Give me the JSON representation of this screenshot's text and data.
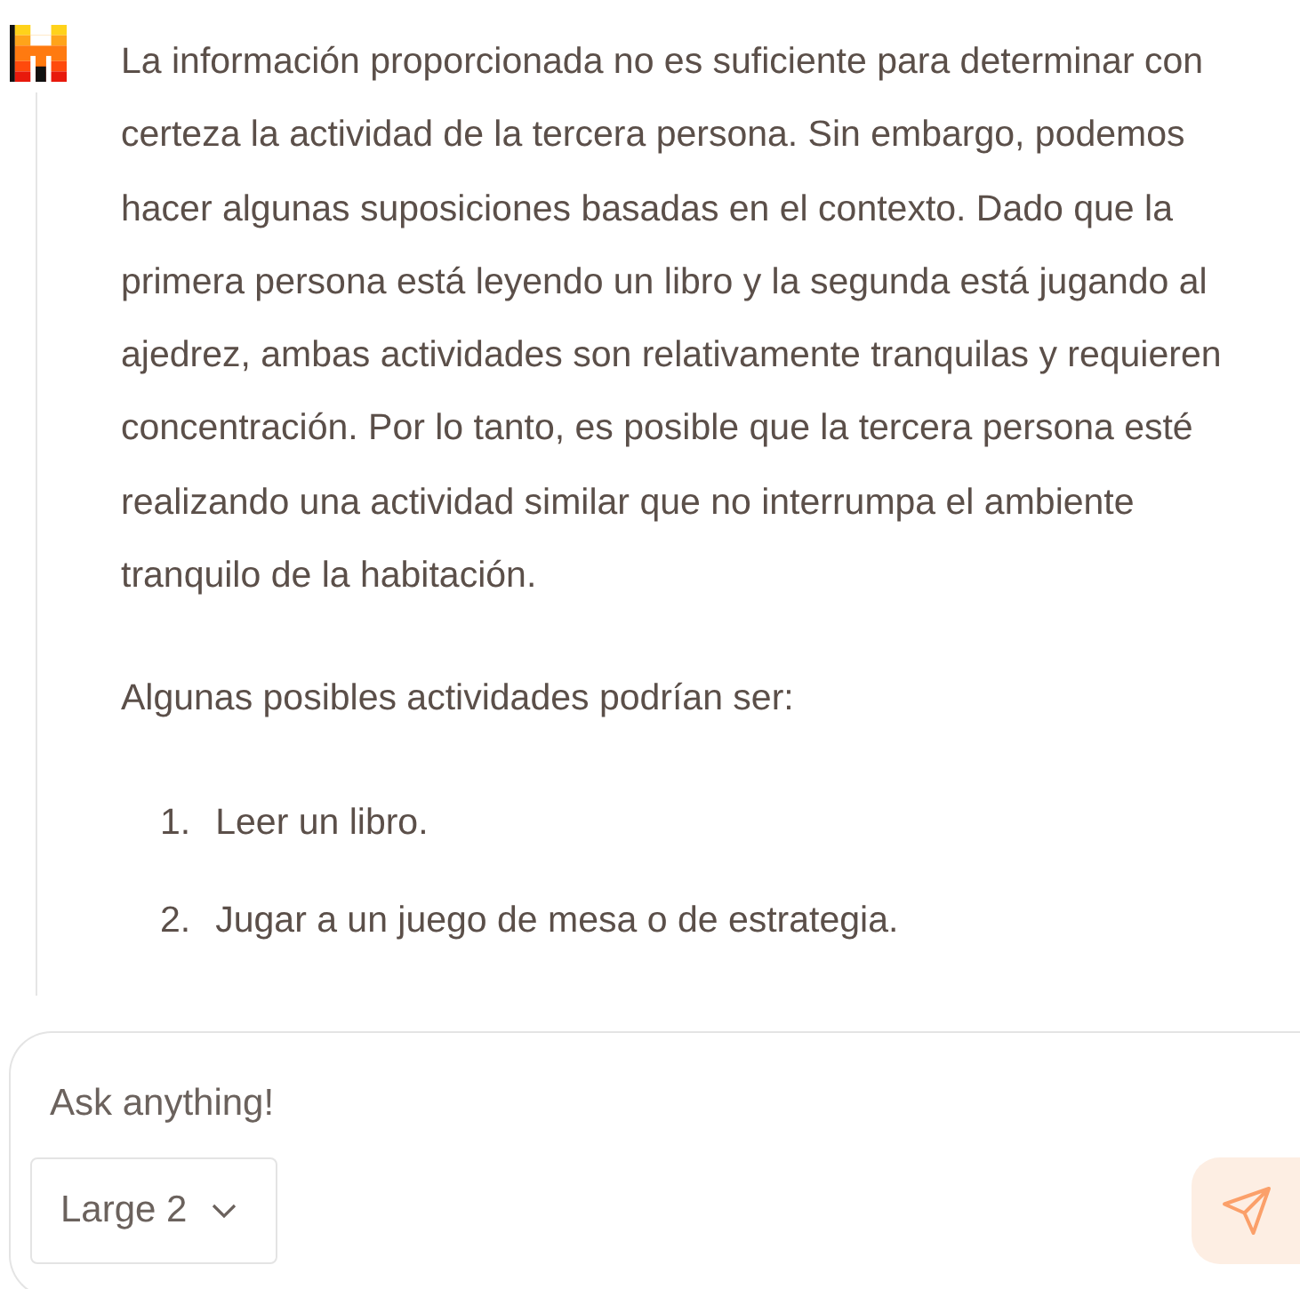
{
  "message": {
    "paragraphs": [
      "La información proporcionada no es suficiente para determinar con certeza la actividad de la tercera persona. Sin embargo, podemos hacer algunas suposiciones basadas en el contexto. Dado que la primera persona está leyendo un libro y la segunda está jugando al ajedrez, ambas actividades son relativamente tranquilas y requieren concentración. Por lo tanto, es posible que la tercera persona esté realizando una actividad similar que no interrumpa el ambiente tranquilo de la habitación.",
      "Algunas posibles actividades podrían ser:"
    ],
    "list": [
      {
        "number": "1.",
        "text": "Leer un libro."
      },
      {
        "number": "2.",
        "text": "Jugar a un juego de mesa o de estrategia."
      }
    ]
  },
  "composer": {
    "placeholder": "Ask anything!",
    "model": "Large 2"
  }
}
